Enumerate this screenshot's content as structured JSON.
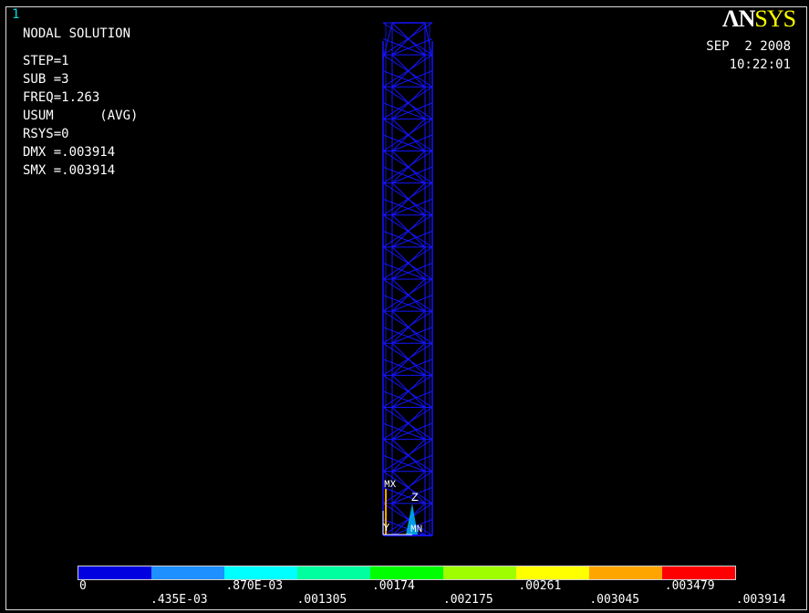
{
  "window_number": "1",
  "logo": {
    "main": "ΛN",
    "accent": "SYS"
  },
  "info": {
    "title": "NODAL SOLUTION",
    "step": "STEP=1",
    "sub": "SUB =3",
    "freq": "FREQ=1.263",
    "usum": "USUM      (AVG)",
    "rsys": "RSYS=0",
    "dmx": "DMX =.003914",
    "smx": "SMX =.003914"
  },
  "date": {
    "day": "SEP  2 2008",
    "time": "10:22:01"
  },
  "markers": {
    "mx": "MX",
    "z": "Z",
    "y": "Y",
    "mn": "MN"
  },
  "legend": {
    "colors": [
      "#0000e0",
      "#1e90ff",
      "#00ffff",
      "#00ff9f",
      "#00ff00",
      "#9fff00",
      "#ffff00",
      "#ffa500",
      "#ff0000"
    ],
    "top_labels": [
      "0",
      ".870E-03",
      ".00174",
      ".00261",
      ".003479"
    ],
    "bottom_labels": [
      ".435E-03",
      ".001305",
      ".002175",
      ".003045",
      ".003914"
    ]
  }
}
